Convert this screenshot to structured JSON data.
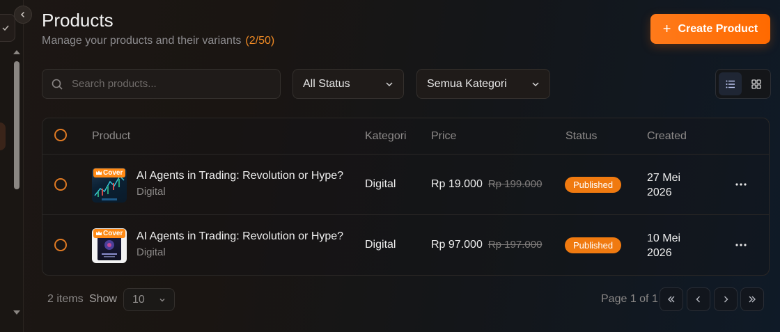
{
  "header": {
    "title": "Products",
    "subtitle": "Manage your products and their variants",
    "count": "(2/50)",
    "create_label": "Create Product"
  },
  "filters": {
    "search_placeholder": "Search products...",
    "status_selected": "All Status",
    "category_selected": "Semua Kategori"
  },
  "table": {
    "columns": {
      "product": "Product",
      "category": "Kategori",
      "price": "Price",
      "status": "Status",
      "created": "Created"
    },
    "rows": [
      {
        "name": "AI Agents in Trading: Revolution or Hype?",
        "subcategory": "Digital",
        "category": "Digital",
        "price": "Rp 19.000",
        "price_old": "Rp 199.000",
        "status": "Published",
        "created": "27 Mei 2026",
        "cover_badge": "Cover"
      },
      {
        "name": "AI Agents in Trading: Revolution or Hype?",
        "subcategory": "Digital",
        "category": "Digital",
        "price": "Rp 97.000",
        "price_old": "Rp 197.000",
        "status": "Published",
        "created": "10 Mei 2026",
        "cover_badge": "Cover"
      }
    ]
  },
  "footer": {
    "items_label": "2 items",
    "show_label": "Show",
    "page_size": "10",
    "page_info": "Page 1 of 1"
  },
  "colors": {
    "accent": "#ff6a00",
    "status_published": "#f07a10"
  }
}
